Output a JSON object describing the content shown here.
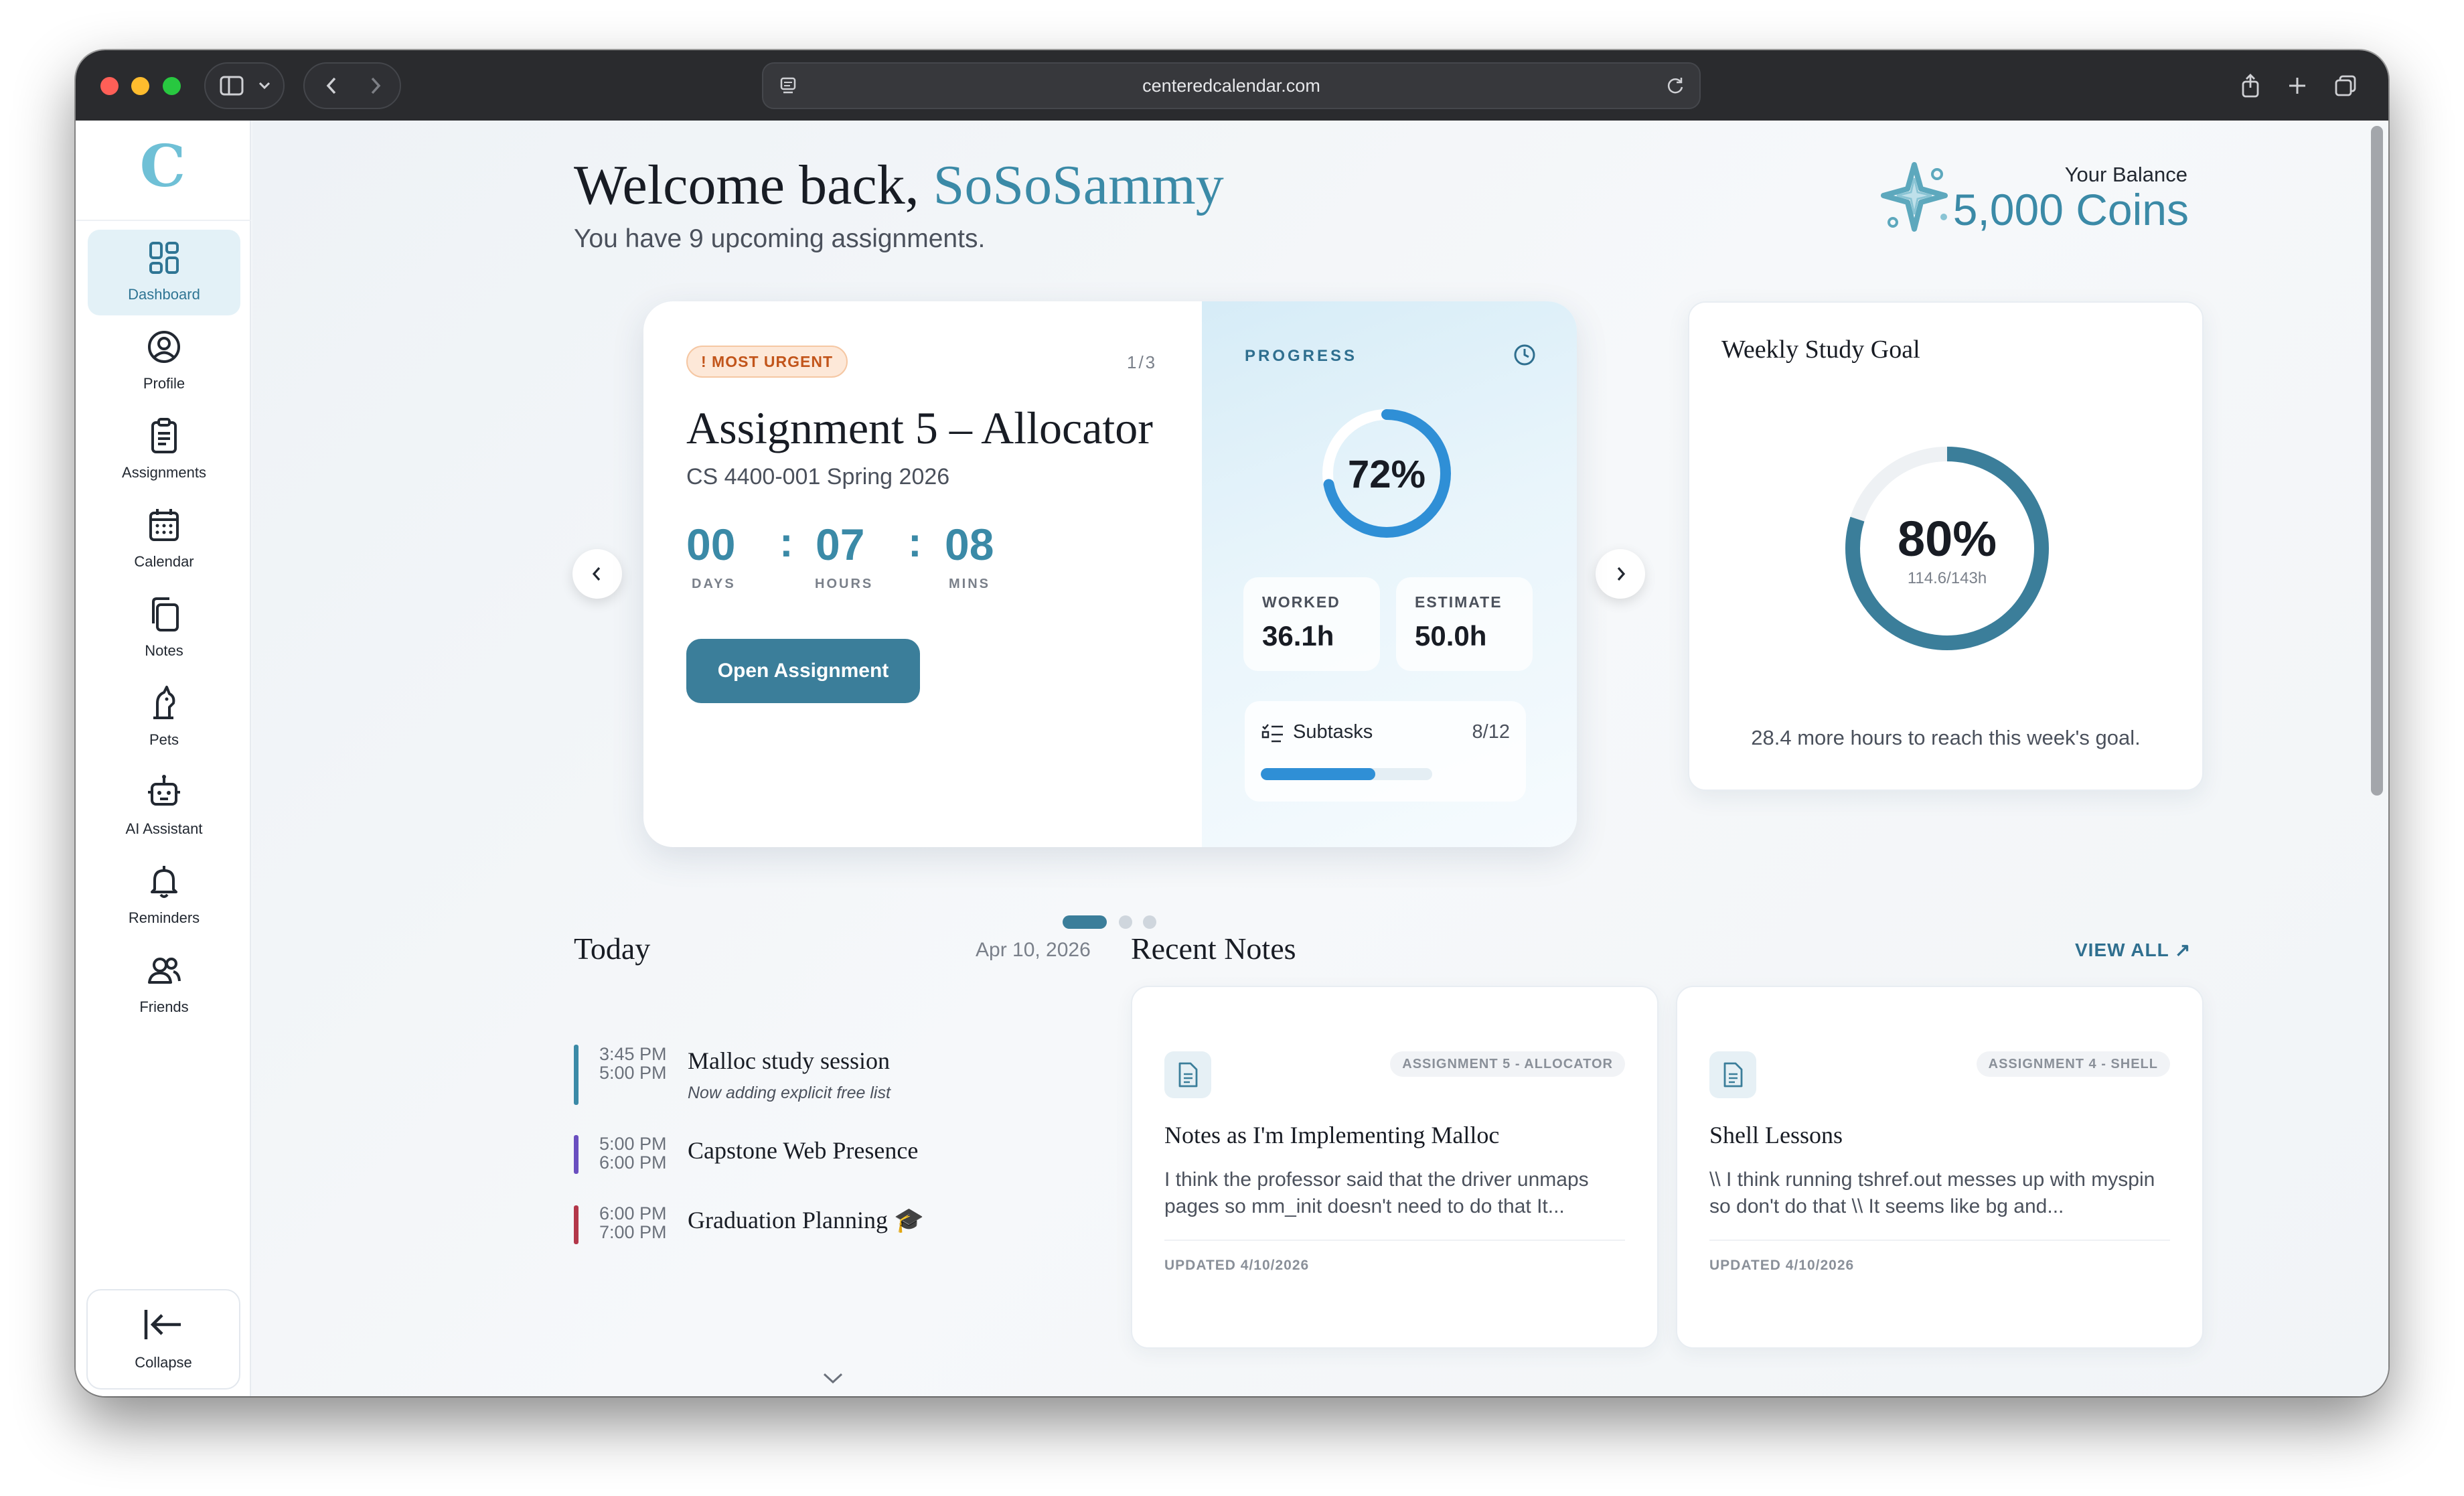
{
  "browser": {
    "url": "centeredcalendar.com"
  },
  "sidebar": {
    "logo_letter": "C",
    "items": [
      {
        "label": "Dashboard",
        "icon": "dashboard-icon",
        "active": true
      },
      {
        "label": "Profile",
        "icon": "profile-icon"
      },
      {
        "label": "Assignments",
        "icon": "clipboard-icon"
      },
      {
        "label": "Calendar",
        "icon": "calendar-icon"
      },
      {
        "label": "Notes",
        "icon": "notes-icon"
      },
      {
        "label": "Pets",
        "icon": "pets-icon"
      },
      {
        "label": "AI Assistant",
        "icon": "robot-icon"
      },
      {
        "label": "Reminders",
        "icon": "bell-icon"
      },
      {
        "label": "Friends",
        "icon": "friends-icon"
      }
    ],
    "collapse_label": "Collapse"
  },
  "header": {
    "welcome_prefix": "Welcome back, ",
    "username": "SoSoSammy",
    "subtitle": "You have 9 upcoming assignments.",
    "balance_label": "Your Balance",
    "balance_value": "5,000 Coins"
  },
  "urgent_card": {
    "badge": "! MOST URGENT",
    "pager": "1/3",
    "title": "Assignment 5 – Allocator",
    "course": "CS 4400-001 Spring 2026",
    "countdown": {
      "days": "00",
      "hours": "07",
      "mins": "08",
      "days_label": "DAYS",
      "hours_label": "HOURS",
      "mins_label": "MINS"
    },
    "open_button": "Open Assignment",
    "progress_label": "PROGRESS",
    "progress_percent": "72%",
    "progress_fraction": 0.72,
    "worked_label": "WORKED",
    "worked_value": "36.1h",
    "estimate_label": "ESTIMATE",
    "estimate_value": "50.0h",
    "subtasks_label": "Subtasks",
    "subtasks_count": "8/12",
    "subtasks_fraction": 0.667
  },
  "carousel": {
    "active_index": 0,
    "total": 3
  },
  "weekly_goal": {
    "title": "Weekly Study Goal",
    "percent": "80%",
    "fraction": 0.8,
    "hours": "114.6/143h",
    "note": "28.4 more hours to reach this week's goal."
  },
  "today": {
    "title": "Today",
    "date": "Apr 10, 2026",
    "events": [
      {
        "start": "3:45 PM",
        "end": "5:00 PM",
        "title": "Malloc study session",
        "subtitle": "Now adding explicit free list",
        "color": "#3b8aa7"
      },
      {
        "start": "5:00 PM",
        "end": "6:00 PM",
        "title": "Capstone Web Presence",
        "subtitle": "",
        "color": "#6a4fc0"
      },
      {
        "start": "6:00 PM",
        "end": "7:00 PM",
        "title": "Graduation Planning 🎓",
        "subtitle": "",
        "color": "#b3374a"
      }
    ]
  },
  "recent_notes": {
    "title": "Recent Notes",
    "view_all": "VIEW ALL ↗",
    "notes": [
      {
        "tag": "ASSIGNMENT 5 - ALLOCATOR",
        "title": "Notes as I'm Implementing Malloc",
        "body": "I think the professor said that the driver unmaps pages so mm_init doesn't need to do that It...",
        "updated": "UPDATED 4/10/2026"
      },
      {
        "tag": "ASSIGNMENT 4 - SHELL",
        "title": "Shell Lessons",
        "body": "\\\\ I think running tshref.out messes up with myspin so don't do that \\\\ It seems like bg and...",
        "updated": "UPDATED 4/10/2026"
      }
    ]
  },
  "colors": {
    "accent": "#3b8aa7",
    "button": "#3b7e9a",
    "urgent": "#c2551b"
  }
}
